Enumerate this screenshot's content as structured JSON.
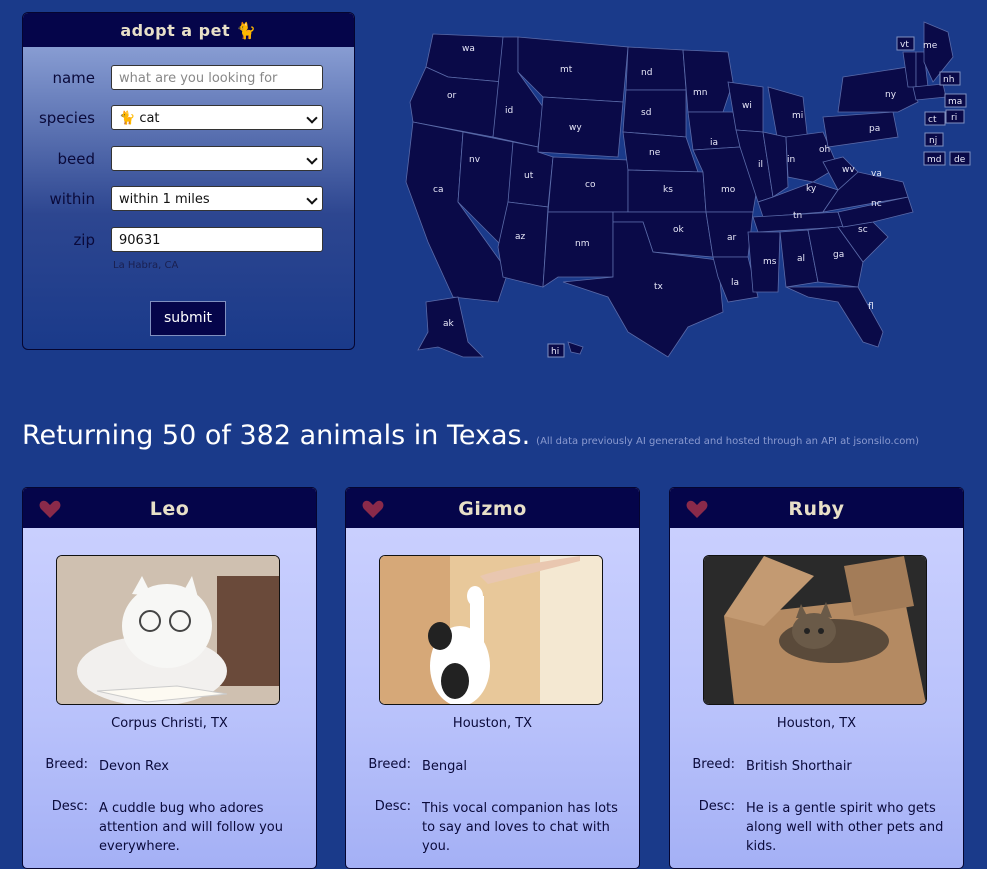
{
  "form": {
    "title": "adopt a pet 🐈",
    "name_label": "name",
    "name_placeholder": "what are you looking for",
    "species_label": "species",
    "species_value": "🐈 cat",
    "breed_label": "beed",
    "breed_value": "",
    "within_label": "within",
    "within_value": "within 1 miles",
    "zip_label": "zip",
    "zip_value": "90631",
    "location_hint": "La Habra, CA",
    "submit_label": "submit"
  },
  "map": {
    "states": [
      "wa",
      "or",
      "ca",
      "id",
      "nv",
      "mt",
      "wy",
      "ut",
      "az",
      "co",
      "nm",
      "nd",
      "sd",
      "ne",
      "ks",
      "ok",
      "tx",
      "mn",
      "ia",
      "mo",
      "ar",
      "la",
      "wi",
      "il",
      "mi",
      "in",
      "oh",
      "ky",
      "tn",
      "ms",
      "al",
      "ga",
      "fl",
      "sc",
      "nc",
      "va",
      "wv",
      "pa",
      "ny",
      "vt",
      "me",
      "nh",
      "ma",
      "ri",
      "ct",
      "nj",
      "md",
      "de",
      "ak",
      "hi"
    ]
  },
  "results": {
    "headline": "Returning 50 of 382 animals in Texas.",
    "note": "(All data previously AI generated and hosted through an API at jsonsilo.com)"
  },
  "cards": [
    {
      "name": "Leo",
      "location": "Corpus Christi, TX",
      "breed_label": "Breed:",
      "breed": "Devon Rex",
      "desc_label": "Desc:",
      "desc": "A cuddle bug who adores attention and will follow you everywhere."
    },
    {
      "name": "Gizmo",
      "location": "Houston, TX",
      "breed_label": "Breed:",
      "breed": "Bengal",
      "desc_label": "Desc:",
      "desc": "This vocal companion has lots to say and loves to chat with you."
    },
    {
      "name": "Ruby",
      "location": "Houston, TX",
      "breed_label": "Breed:",
      "breed": "British Shorthair",
      "desc_label": "Desc:",
      "desc": "He is a gentle spirit who gets along well with other pets and kids."
    }
  ],
  "colors": {
    "background": "#1a3a8a",
    "navy": "#05054a",
    "heart": "#8a2a4a",
    "card_top": "#cdd2ff"
  }
}
